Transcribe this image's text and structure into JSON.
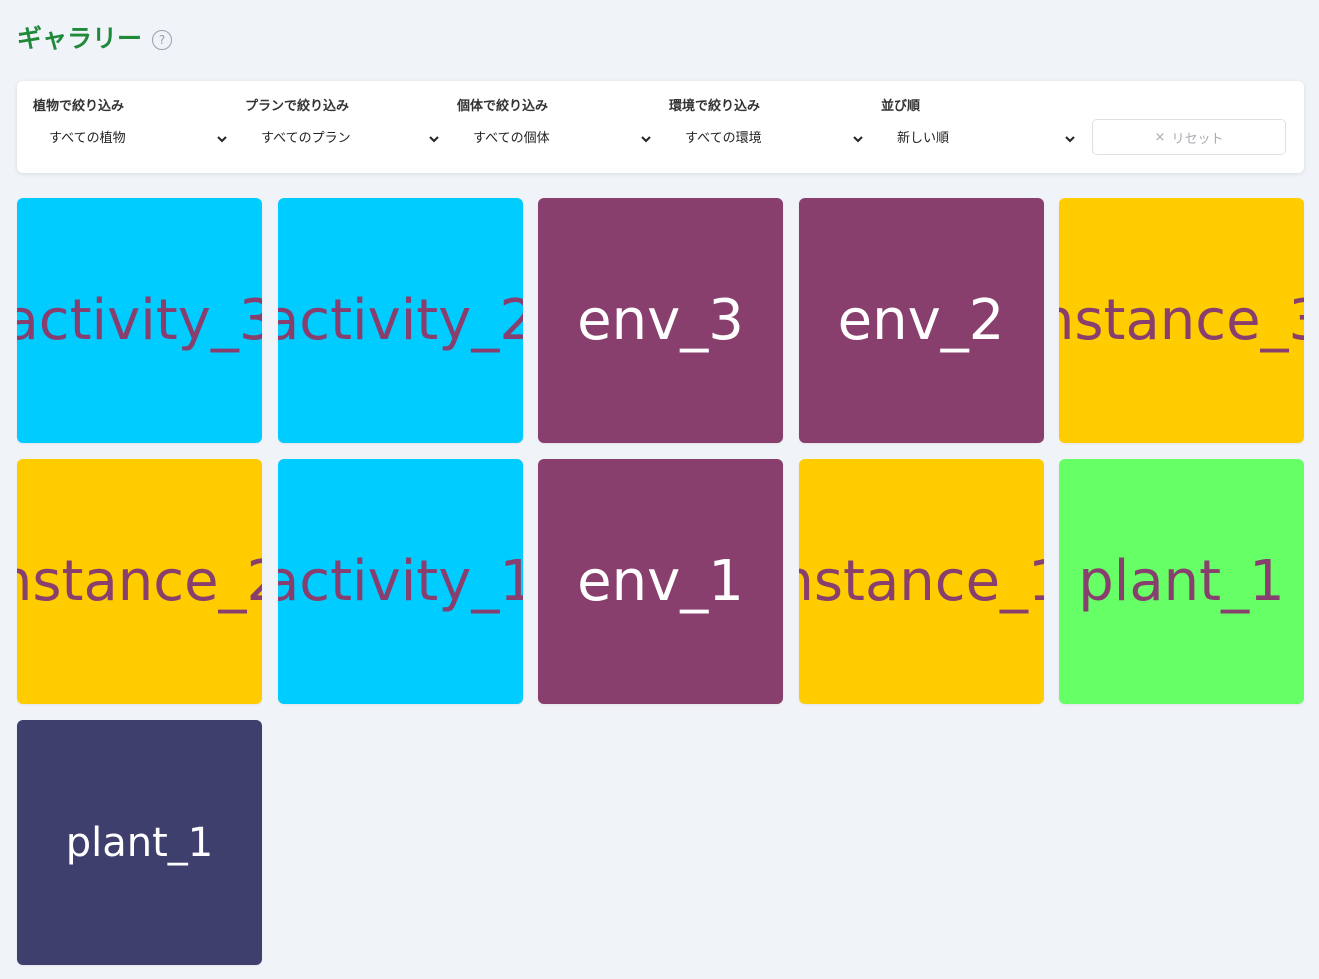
{
  "page": {
    "title": "ギャラリー",
    "help_glyph": "?"
  },
  "filters": [
    {
      "label": "植物で絞り込み",
      "value": "すべての植物"
    },
    {
      "label": "プランで絞り込み",
      "value": "すべてのプラン"
    },
    {
      "label": "個体で絞り込み",
      "value": "すべての個体"
    },
    {
      "label": "環境で絞り込み",
      "value": "すべての環境"
    },
    {
      "label": "並び順",
      "value": "新しい順"
    }
  ],
  "reset": {
    "icon": "×",
    "label": "リセット"
  },
  "colors": {
    "title": "#1f8a3a",
    "activity": "#00ccff",
    "env": "#883f6e",
    "instance": "#ffcc00",
    "plant_green": "#66ff66",
    "plant_navy": "#3f3f6d",
    "purple_text": "#883f6e",
    "white_text": "#ffffff"
  },
  "gallery": [
    {
      "label": "activity_3",
      "bg": "#00ccff",
      "fg": "#883f6e"
    },
    {
      "label": "activity_2",
      "bg": "#00ccff",
      "fg": "#883f6e"
    },
    {
      "label": "env_3",
      "bg": "#883f6e",
      "fg": "#ffffff"
    },
    {
      "label": "env_2",
      "bg": "#883f6e",
      "fg": "#ffffff"
    },
    {
      "label": "nstance_3",
      "bg": "#ffcc00",
      "fg": "#883f6e"
    },
    {
      "label": "nstance_2",
      "bg": "#ffcc00",
      "fg": "#883f6e"
    },
    {
      "label": "activity_1",
      "bg": "#00ccff",
      "fg": "#883f6e"
    },
    {
      "label": "env_1",
      "bg": "#883f6e",
      "fg": "#ffffff"
    },
    {
      "label": "nstance_1",
      "bg": "#ffcc00",
      "fg": "#883f6e"
    },
    {
      "label": "plant_1",
      "bg": "#66ff66",
      "fg": "#883f6e"
    },
    {
      "label": "plant_1",
      "bg": "#3f3f6d",
      "fg": "#ffffff"
    }
  ]
}
